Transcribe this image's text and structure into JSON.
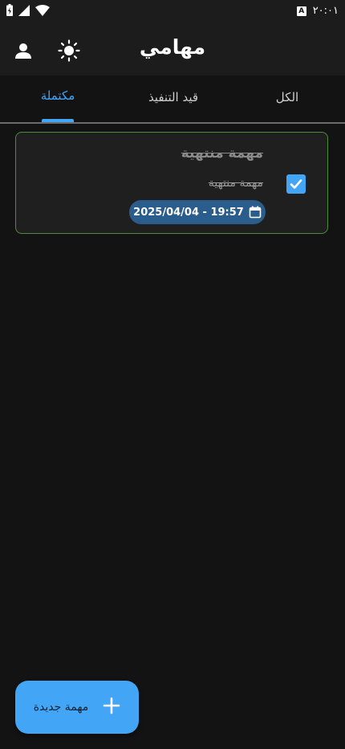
{
  "status_bar": {
    "time": "٢٠:٠١",
    "input_badge": "A",
    "icons": [
      "battery-charging-icon",
      "signal-icon",
      "wifi-icon"
    ]
  },
  "app_bar": {
    "title": "مهامي",
    "icons": [
      "user-icon",
      "sun-icon"
    ]
  },
  "tabs": {
    "all": "الكل",
    "in_progress": "قيد التنفيذ",
    "completed": "مكتملة",
    "active": "completed"
  },
  "tasks": [
    {
      "title": "مهمة منتهية",
      "description": "مهمة منتهية",
      "date": "2025/04/04 - 19:57",
      "completed": true
    }
  ],
  "fab": {
    "label": "مهمة جديدة",
    "icon": "plus-icon"
  },
  "colors": {
    "accent": "#42a5f5",
    "background": "#131313",
    "surface": "#1c1c1c",
    "card_border": "#4d8c3a",
    "date_chip": "#2b5d8c"
  }
}
